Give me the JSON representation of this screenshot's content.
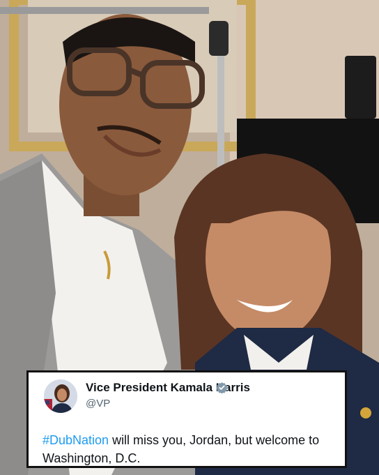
{
  "tweet": {
    "author_name": "Vice President Kamala Harris",
    "handle": "@VP",
    "hashtag": "#DubNation",
    "text_rest": " will miss you, Jordan, but welcome to Washington, D.C."
  },
  "icons": {
    "verified": "verified-badge-icon",
    "avatar": "profile-photo"
  },
  "colors": {
    "hashtag": "#1d9bf0",
    "verified_badge": "#829aab",
    "handle": "#536471"
  }
}
